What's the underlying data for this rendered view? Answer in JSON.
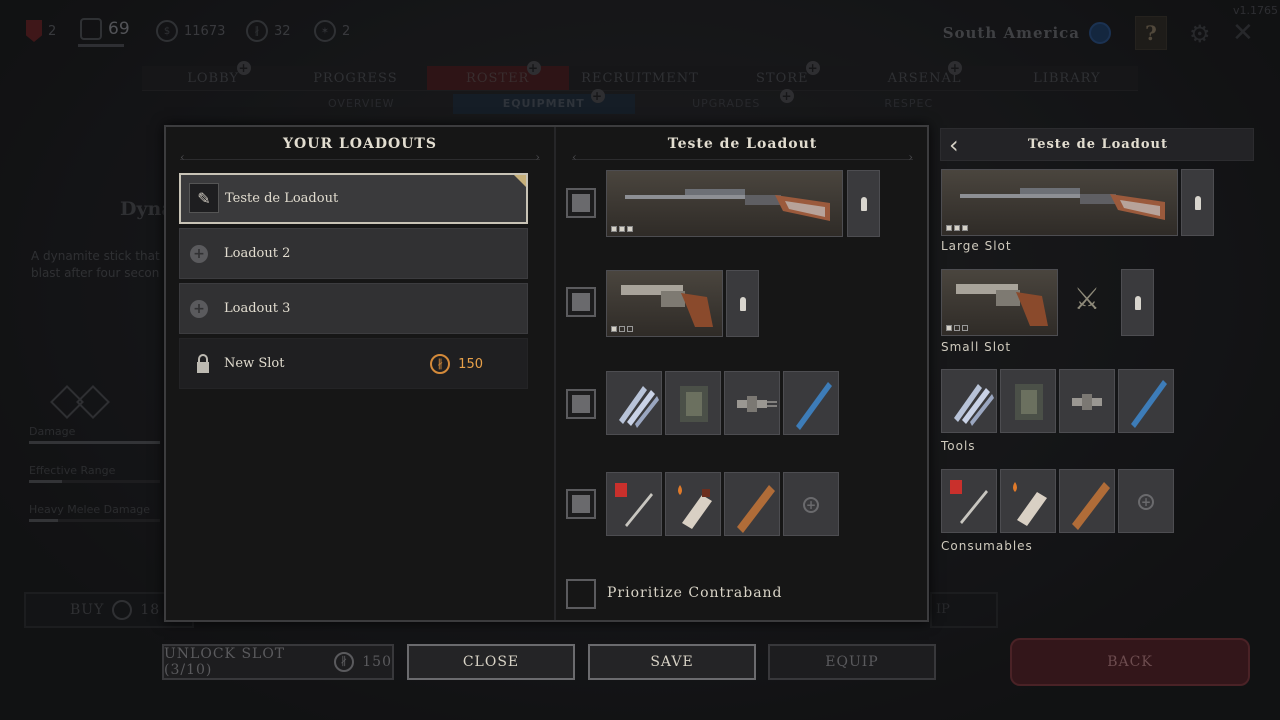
{
  "hud": {
    "rank_value": "2",
    "level": "69",
    "currency_value": "11673",
    "bloodbonds_value": "32",
    "tokens_value": "2",
    "region": "South America",
    "version": "v1.1765"
  },
  "nav": {
    "tabs": [
      "LOBBY",
      "PROGRESS",
      "ROSTER",
      "RECRUITMENT",
      "STORE",
      "ARSENAL",
      "LIBRARY"
    ],
    "subtabs": [
      "OVERVIEW",
      "EQUIPMENT",
      "UPGRADES",
      "RESPEC"
    ]
  },
  "background": {
    "item_title": "Dyna",
    "item_desc_line1": "A dynamite stick that",
    "item_desc_line2": "blast after four secon",
    "stats": [
      "Damage",
      "Effective Range",
      "Heavy Melee Damage"
    ],
    "buy_label": "BUY",
    "buy_cost": "18",
    "right_fragment": "IP"
  },
  "modal": {
    "loadouts_title": "YOUR LOADOUTS",
    "loadouts": [
      {
        "name": "Teste de Loadout"
      },
      {
        "name": "Loadout 2"
      },
      {
        "name": "Loadout 3"
      },
      {
        "name": "New Slot",
        "cost": "150"
      }
    ],
    "loadout_detail_title": "Teste de Loadout",
    "prioritize_label": "Prioritize Contraband"
  },
  "preview": {
    "title": "Teste de Loadout",
    "large_slot_label": "Large Slot",
    "small_slot_label": "Small Slot",
    "tools_label": "Tools",
    "consumables_label": "Consumables"
  },
  "buttons": {
    "unlock_label": "UNLOCK SLOT (3/10)",
    "unlock_cost": "150",
    "close": "CLOSE",
    "save": "SAVE",
    "equip": "EQUIP",
    "back": "BACK"
  }
}
